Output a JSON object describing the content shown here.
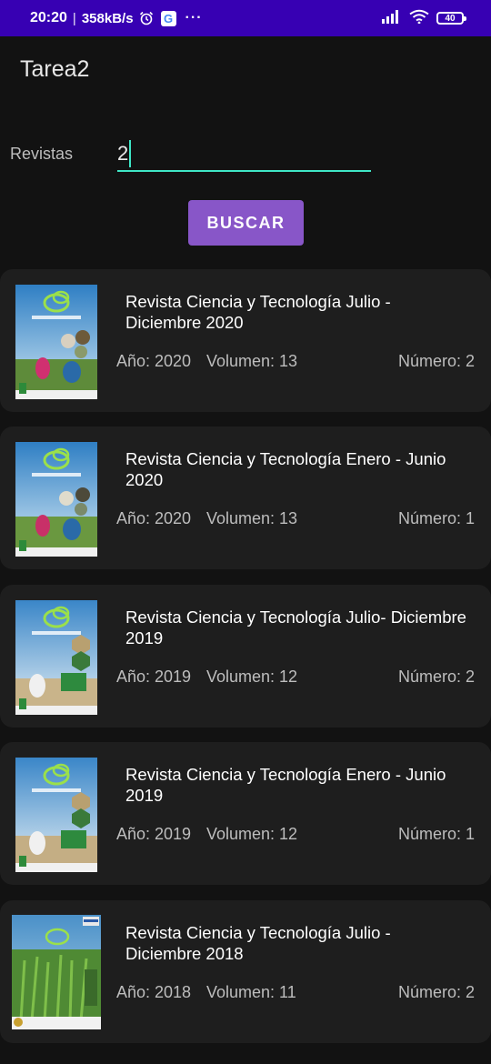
{
  "status_bar": {
    "time": "20:20",
    "separator": "|",
    "speed": "358kB/s",
    "google": "G",
    "more": "···",
    "battery": "40"
  },
  "app": {
    "title": "Tarea2"
  },
  "search": {
    "label": "Revistas",
    "value": "2",
    "button_label": "BUSCAR"
  },
  "journals": [
    {
      "title": "Revista Ciencia y Tecnología Julio - Diciembre 2020",
      "year": "Año: 2020",
      "volume": "Volumen: 13",
      "number": "Número: 2"
    },
    {
      "title": "Revista Ciencia y Tecnología Enero - Junio 2020",
      "year": "Año: 2020",
      "volume": "Volumen: 13",
      "number": "Número: 1"
    },
    {
      "title": "Revista Ciencia y Tecnología Julio- Diciembre 2019",
      "year": "Año: 2019",
      "volume": "Volumen: 12",
      "number": "Número: 2"
    },
    {
      "title": "Revista Ciencia y Tecnología Enero - Junio 2019",
      "year": "Año: 2019",
      "volume": "Volumen: 12",
      "number": "Número: 1"
    },
    {
      "title": "Revista Ciencia y Tecnología Julio - Diciembre 2018",
      "year": "Año: 2018",
      "volume": "Volumen: 11",
      "number": "Número: 2"
    }
  ],
  "colors": {
    "status_bar": "#3700b3",
    "background": "#121212",
    "card": "#1e1e1e",
    "accent_button": "#8856c8",
    "input_underline": "#3ee6c6"
  },
  "icons": {
    "alarm": "alarm-clock-icon",
    "signal": "cell-signal-icon",
    "wifi": "wifi-icon",
    "battery": "battery-icon"
  }
}
